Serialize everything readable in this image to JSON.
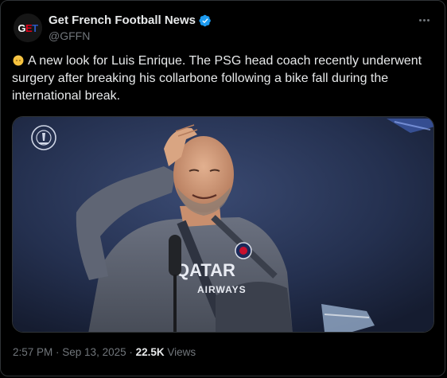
{
  "author": {
    "name": "Get French Football News",
    "handle": "@GFFN",
    "avatar_text": "GET"
  },
  "tweet": {
    "emoji_name": "person-emoji",
    "text": "A new look for Luis Enrique. The PSG head coach recently underwent surgery after breaking his collarbone following a bike fall during the international break."
  },
  "media": {
    "jersey_text": "QATAR AIRWAYS"
  },
  "meta": {
    "time": "2:57 PM",
    "separator": " · ",
    "date": "Sep 13, 2025",
    "views_count": "22.5K",
    "views_label": "Views"
  },
  "colors": {
    "background": "#000000",
    "text": "#e7e9ea",
    "muted": "#71767b",
    "verified": "#1d9bf0",
    "border": "#2f3336"
  }
}
